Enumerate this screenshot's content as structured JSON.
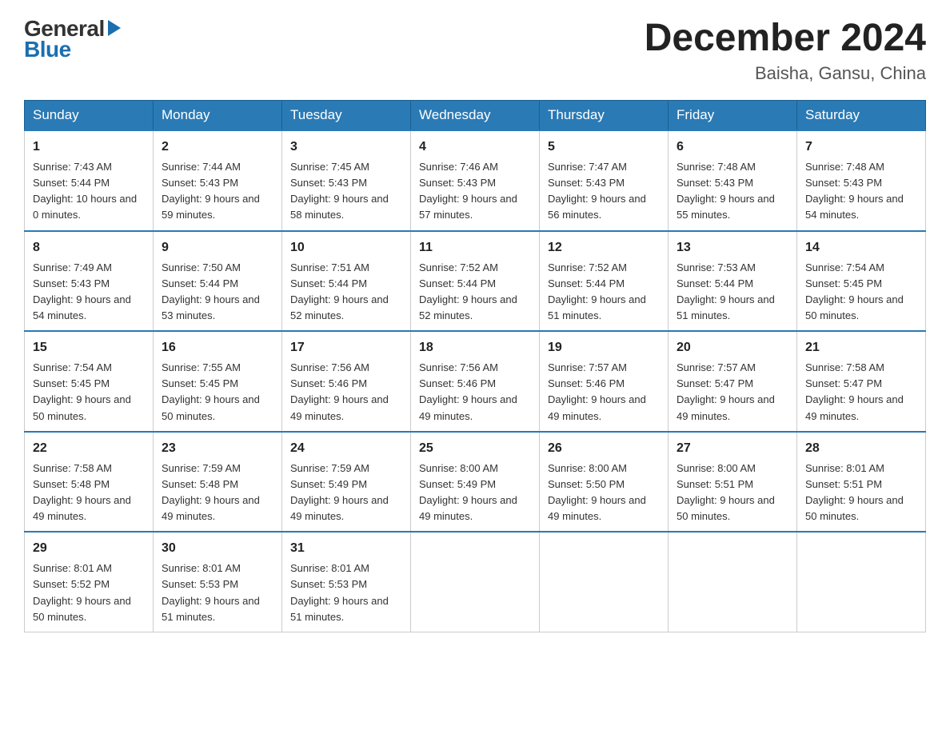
{
  "logo": {
    "general": "General",
    "blue": "Blue"
  },
  "title": "December 2024",
  "subtitle": "Baisha, Gansu, China",
  "days_of_week": [
    "Sunday",
    "Monday",
    "Tuesday",
    "Wednesday",
    "Thursday",
    "Friday",
    "Saturday"
  ],
  "weeks": [
    [
      {
        "day": "1",
        "sunrise": "7:43 AM",
        "sunset": "5:44 PM",
        "daylight": "10 hours and 0 minutes."
      },
      {
        "day": "2",
        "sunrise": "7:44 AM",
        "sunset": "5:43 PM",
        "daylight": "9 hours and 59 minutes."
      },
      {
        "day": "3",
        "sunrise": "7:45 AM",
        "sunset": "5:43 PM",
        "daylight": "9 hours and 58 minutes."
      },
      {
        "day": "4",
        "sunrise": "7:46 AM",
        "sunset": "5:43 PM",
        "daylight": "9 hours and 57 minutes."
      },
      {
        "day": "5",
        "sunrise": "7:47 AM",
        "sunset": "5:43 PM",
        "daylight": "9 hours and 56 minutes."
      },
      {
        "day": "6",
        "sunrise": "7:48 AM",
        "sunset": "5:43 PM",
        "daylight": "9 hours and 55 minutes."
      },
      {
        "day": "7",
        "sunrise": "7:48 AM",
        "sunset": "5:43 PM",
        "daylight": "9 hours and 54 minutes."
      }
    ],
    [
      {
        "day": "8",
        "sunrise": "7:49 AM",
        "sunset": "5:43 PM",
        "daylight": "9 hours and 54 minutes."
      },
      {
        "day": "9",
        "sunrise": "7:50 AM",
        "sunset": "5:44 PM",
        "daylight": "9 hours and 53 minutes."
      },
      {
        "day": "10",
        "sunrise": "7:51 AM",
        "sunset": "5:44 PM",
        "daylight": "9 hours and 52 minutes."
      },
      {
        "day": "11",
        "sunrise": "7:52 AM",
        "sunset": "5:44 PM",
        "daylight": "9 hours and 52 minutes."
      },
      {
        "day": "12",
        "sunrise": "7:52 AM",
        "sunset": "5:44 PM",
        "daylight": "9 hours and 51 minutes."
      },
      {
        "day": "13",
        "sunrise": "7:53 AM",
        "sunset": "5:44 PM",
        "daylight": "9 hours and 51 minutes."
      },
      {
        "day": "14",
        "sunrise": "7:54 AM",
        "sunset": "5:45 PM",
        "daylight": "9 hours and 50 minutes."
      }
    ],
    [
      {
        "day": "15",
        "sunrise": "7:54 AM",
        "sunset": "5:45 PM",
        "daylight": "9 hours and 50 minutes."
      },
      {
        "day": "16",
        "sunrise": "7:55 AM",
        "sunset": "5:45 PM",
        "daylight": "9 hours and 50 minutes."
      },
      {
        "day": "17",
        "sunrise": "7:56 AM",
        "sunset": "5:46 PM",
        "daylight": "9 hours and 49 minutes."
      },
      {
        "day": "18",
        "sunrise": "7:56 AM",
        "sunset": "5:46 PM",
        "daylight": "9 hours and 49 minutes."
      },
      {
        "day": "19",
        "sunrise": "7:57 AM",
        "sunset": "5:46 PM",
        "daylight": "9 hours and 49 minutes."
      },
      {
        "day": "20",
        "sunrise": "7:57 AM",
        "sunset": "5:47 PM",
        "daylight": "9 hours and 49 minutes."
      },
      {
        "day": "21",
        "sunrise": "7:58 AM",
        "sunset": "5:47 PM",
        "daylight": "9 hours and 49 minutes."
      }
    ],
    [
      {
        "day": "22",
        "sunrise": "7:58 AM",
        "sunset": "5:48 PM",
        "daylight": "9 hours and 49 minutes."
      },
      {
        "day": "23",
        "sunrise": "7:59 AM",
        "sunset": "5:48 PM",
        "daylight": "9 hours and 49 minutes."
      },
      {
        "day": "24",
        "sunrise": "7:59 AM",
        "sunset": "5:49 PM",
        "daylight": "9 hours and 49 minutes."
      },
      {
        "day": "25",
        "sunrise": "8:00 AM",
        "sunset": "5:49 PM",
        "daylight": "9 hours and 49 minutes."
      },
      {
        "day": "26",
        "sunrise": "8:00 AM",
        "sunset": "5:50 PM",
        "daylight": "9 hours and 49 minutes."
      },
      {
        "day": "27",
        "sunrise": "8:00 AM",
        "sunset": "5:51 PM",
        "daylight": "9 hours and 50 minutes."
      },
      {
        "day": "28",
        "sunrise": "8:01 AM",
        "sunset": "5:51 PM",
        "daylight": "9 hours and 50 minutes."
      }
    ],
    [
      {
        "day": "29",
        "sunrise": "8:01 AM",
        "sunset": "5:52 PM",
        "daylight": "9 hours and 50 minutes."
      },
      {
        "day": "30",
        "sunrise": "8:01 AM",
        "sunset": "5:53 PM",
        "daylight": "9 hours and 51 minutes."
      },
      {
        "day": "31",
        "sunrise": "8:01 AM",
        "sunset": "5:53 PM",
        "daylight": "9 hours and 51 minutes."
      },
      null,
      null,
      null,
      null
    ]
  ]
}
